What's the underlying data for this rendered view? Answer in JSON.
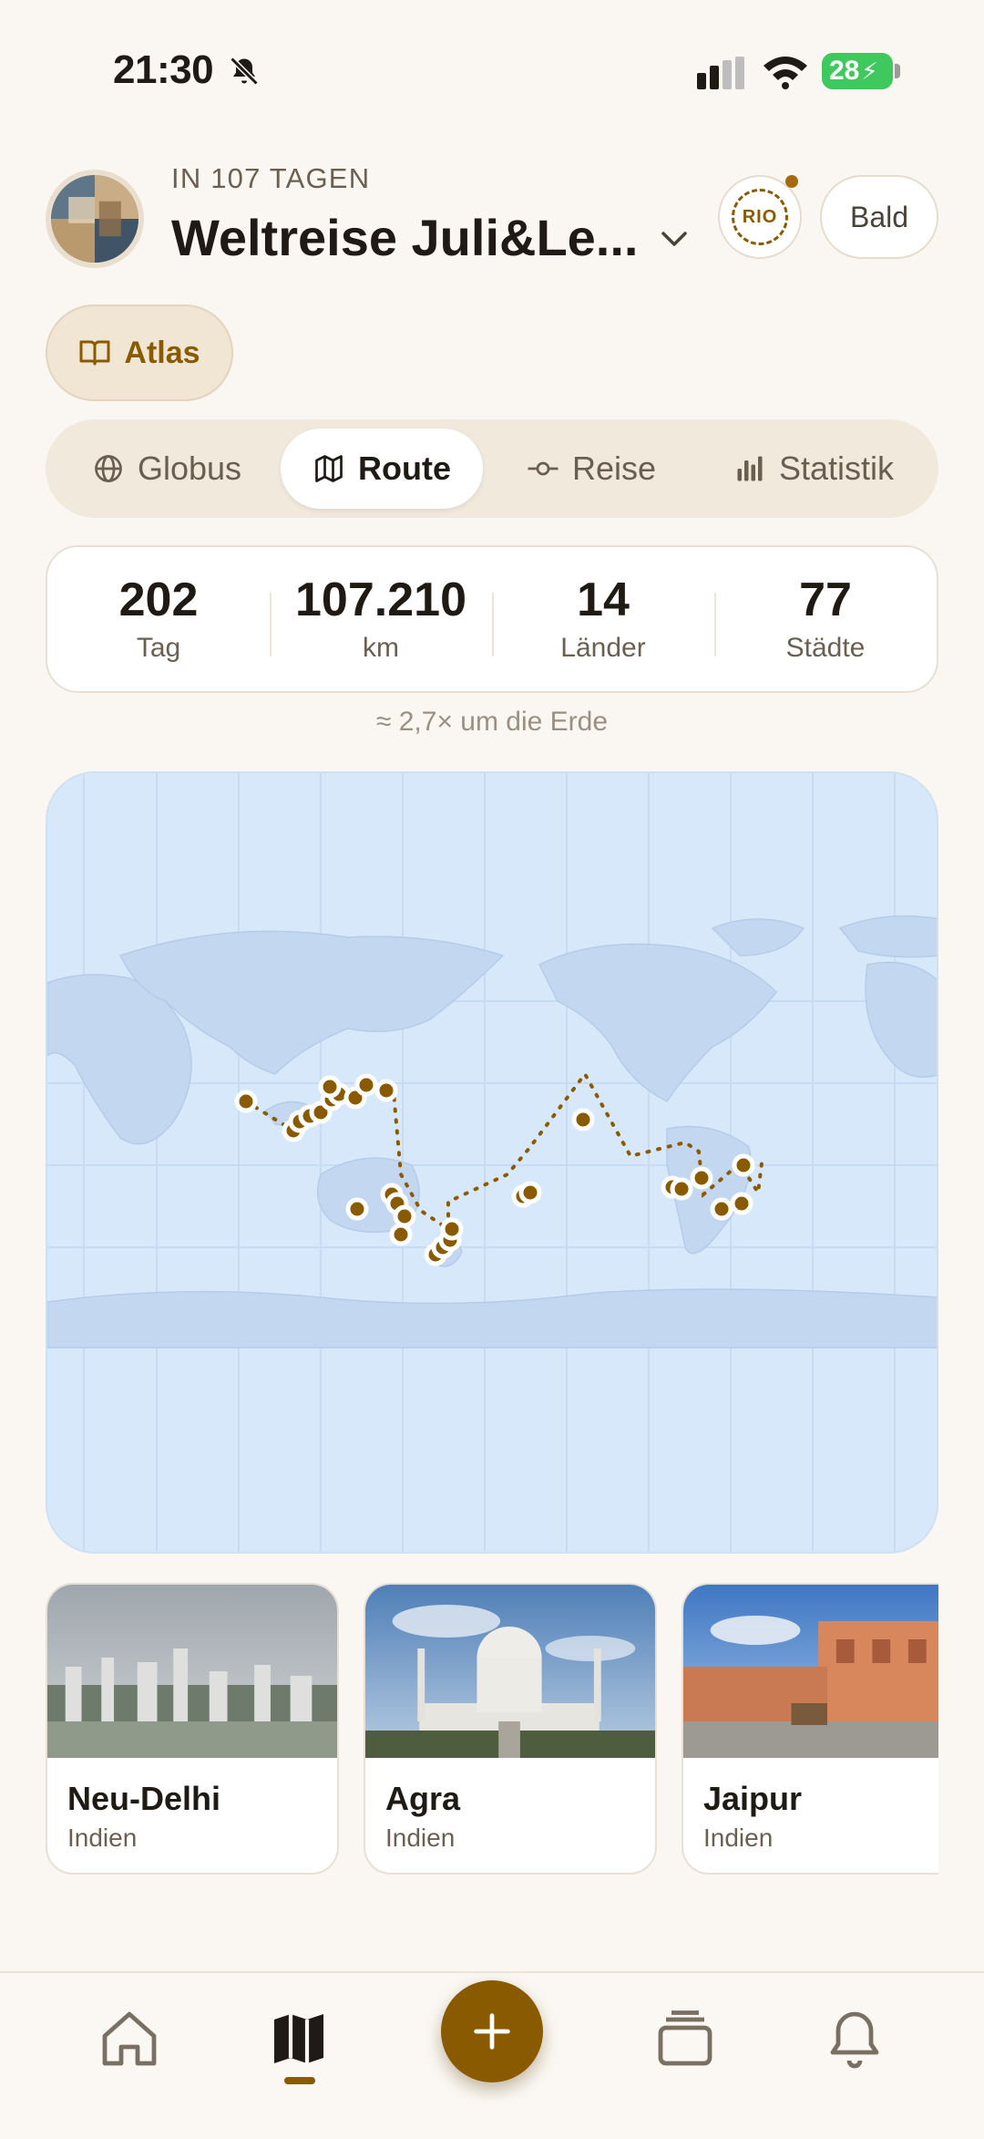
{
  "status_bar": {
    "time": "21:30",
    "battery": "28"
  },
  "header": {
    "eyebrow": "IN 107 TAGEN",
    "title": "Weltreise Juli&Le...",
    "badge_text": "RIO",
    "soon_button": "Bald"
  },
  "atlas_chip": {
    "label": "Atlas"
  },
  "tabs": [
    {
      "label": "Globus",
      "icon": "globe-icon",
      "active": false
    },
    {
      "label": "Route",
      "icon": "map-icon",
      "active": true
    },
    {
      "label": "Reise",
      "icon": "commit-icon",
      "active": false
    },
    {
      "label": "Statistik",
      "icon": "bar-chart-icon",
      "active": false
    }
  ],
  "stats": [
    {
      "value": "202",
      "label": "Tag"
    },
    {
      "value": "107.210",
      "label": "km"
    },
    {
      "value": "14",
      "label": "Länder"
    },
    {
      "value": "77",
      "label": "Städte"
    }
  ],
  "earth_note": "≈ 2,7× um die Erde",
  "map": {
    "route_color": "#8a5a00",
    "water_color": "#d8e8fb",
    "land_color": "#c3d8f0"
  },
  "cities": [
    {
      "name": "Neu-Delhi",
      "country": "Indien"
    },
    {
      "name": "Agra",
      "country": "Indien"
    },
    {
      "name": "Jaipur",
      "country": "Indien"
    }
  ],
  "bottom_nav": {
    "items": [
      "home-icon",
      "map-icon",
      "add-icon",
      "cards-icon",
      "bell-icon"
    ],
    "accent": "#8a5a00"
  }
}
